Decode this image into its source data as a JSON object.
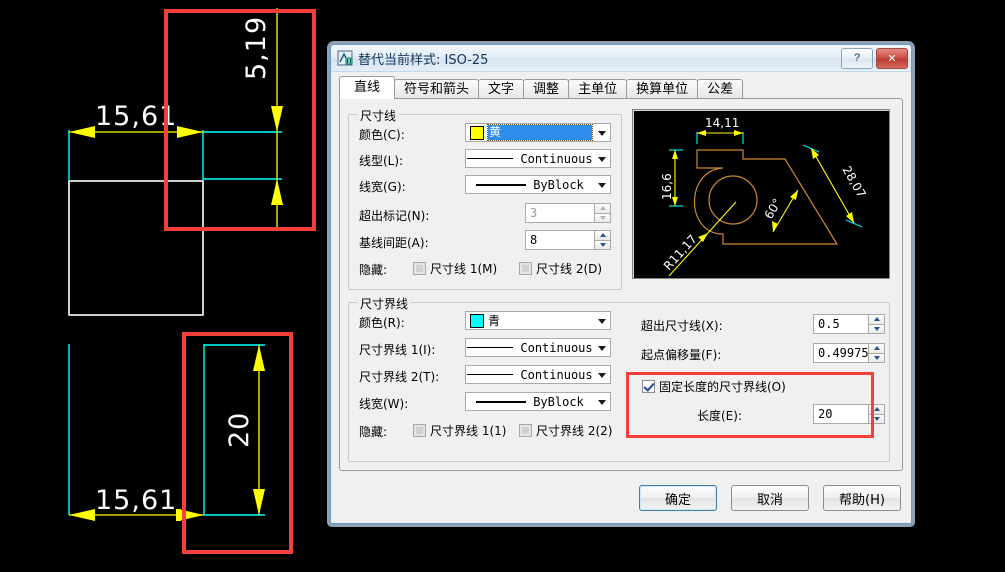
{
  "cad": {
    "background": "#000000",
    "colors": {
      "geometry": "#ffffff",
      "dimension_line": "#ffff00",
      "extension_line": "#00ffff",
      "annotation_box": "#f4403a"
    },
    "top_drawing": {
      "horizontal_dim_text": "15,61",
      "vertical_dim_text": "5,19"
    },
    "bottom_drawing": {
      "horizontal_dim_text": "15,61",
      "vertical_dim_text": "20"
    }
  },
  "dialog": {
    "title": "替代当前样式: ISO-25",
    "icon": "autocad-dimstyle-icon",
    "help_button": "?",
    "close_button": "✕",
    "tabs": [
      {
        "label": "直线",
        "active": true
      },
      {
        "label": "符号和箭头",
        "active": false
      },
      {
        "label": "文字",
        "active": false
      },
      {
        "label": "调整",
        "active": false
      },
      {
        "label": "主单位",
        "active": false
      },
      {
        "label": "换算单位",
        "active": false
      },
      {
        "label": "公差",
        "active": false
      }
    ],
    "dimension_line_group": {
      "legend": "尺寸线",
      "color_label": "颜色(C):",
      "color_value": "黄",
      "color_swatch": "#ffff00",
      "linetype_label": "线型(L):",
      "linetype_value": "Continuous",
      "lineweight_label": "线宽(G):",
      "lineweight_value": "ByBlock",
      "extend_beyond_label": "超出标记(N):",
      "extend_beyond_value": "3",
      "extend_beyond_disabled": true,
      "baseline_spacing_label": "基线间距(A):",
      "baseline_spacing_value": "8",
      "hide_label": "隐藏:",
      "hide_dimline1": "尺寸线 1(M)",
      "hide_dimline2": "尺寸线 2(D)",
      "hide_dimline1_checked": false,
      "hide_dimline2_checked": false
    },
    "extension_line_group": {
      "legend": "尺寸界线",
      "color_label": "颜色(R):",
      "color_value": "青",
      "color_swatch": "#00ffff",
      "extline1_label": "尺寸界线 1(I):",
      "extline1_value": "Continuous",
      "extline2_label": "尺寸界线 2(T):",
      "extline2_value": "Continuous",
      "lineweight_label": "线宽(W):",
      "lineweight_value": "ByBlock",
      "hide_label": "隐藏:",
      "hide_extline1": "尺寸界线 1(1)",
      "hide_extline2": "尺寸界线 2(2)",
      "hide_extline1_checked": false,
      "hide_extline2_checked": false,
      "extend_beyond_dimline_label": "超出尺寸线(X):",
      "extend_beyond_dimline_value": "0.5",
      "offset_from_origin_label": "起点偏移量(F):",
      "offset_from_origin_value": "0.49975",
      "fixed_length_label": "固定长度的尺寸界线(O)",
      "fixed_length_checked": true,
      "length_label": "长度(E):",
      "length_value": "20"
    },
    "preview": {
      "dim_top": "14,11",
      "dim_left": "16,6",
      "dim_right": "28,07",
      "dim_angle": "60°",
      "dim_radius": "R11,17",
      "shape_color": "#cc8833",
      "dim_color": "#ffff00",
      "ext_color": "#00e5e5"
    },
    "buttons": {
      "ok": "确定",
      "cancel": "取消",
      "help": "帮助(H)"
    }
  }
}
